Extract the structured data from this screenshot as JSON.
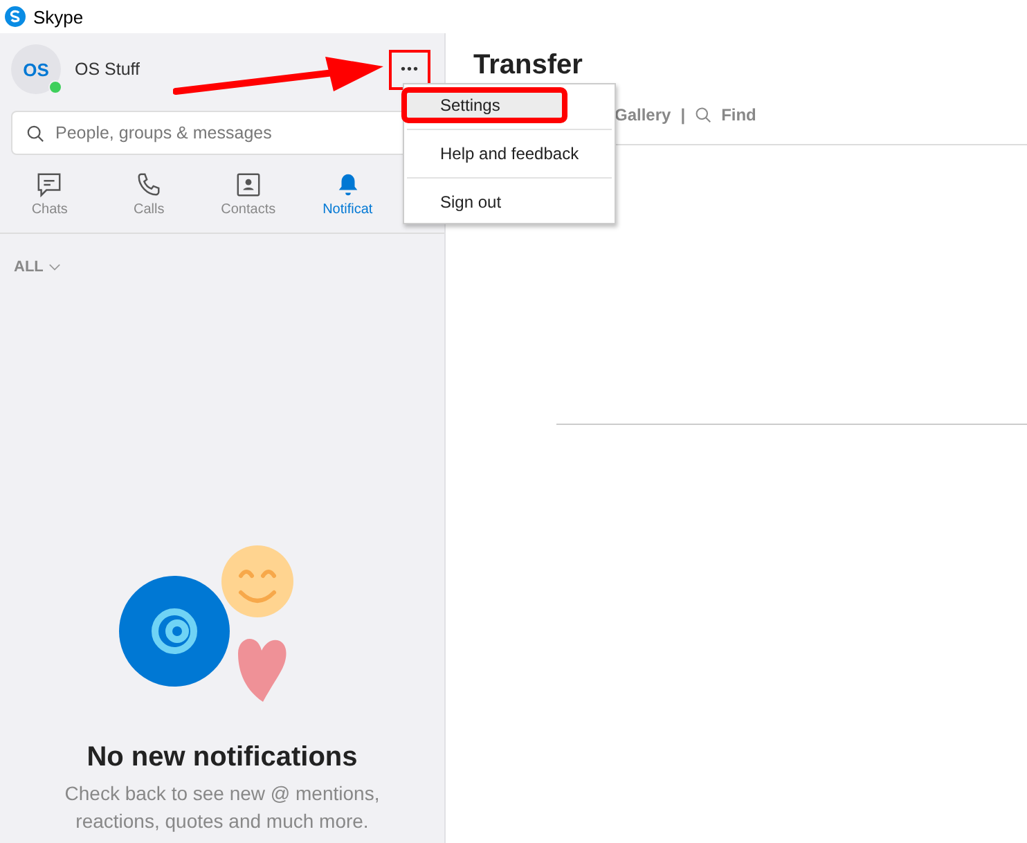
{
  "window": {
    "title": "Skype"
  },
  "profile": {
    "initials": "OS",
    "name": "OS Stuff",
    "online": true,
    "more": "•••",
    "highlighted": true
  },
  "search": {
    "placeholder": "People, groups & messages"
  },
  "tabs": [
    {
      "label": "Chats",
      "selected": false
    },
    {
      "label": "Calls",
      "selected": false
    },
    {
      "label": "Contacts",
      "selected": false
    },
    {
      "label": "Notificat",
      "selected": true
    }
  ],
  "filter": {
    "label": "ALL"
  },
  "empty_state": {
    "title": "No new notifications",
    "text": "Check back to see new @ mentions, reactions, quotes and much more."
  },
  "conversation": {
    "title": "Transfer",
    "toolbar": [
      "Gallery",
      "|",
      "Find"
    ]
  },
  "menu": {
    "items": [
      {
        "label": "Settings",
        "selected": true,
        "highlighted": true
      },
      {
        "label": "Help and feedback",
        "selected": false,
        "highlighted": false
      },
      {
        "label": "Sign out",
        "selected": false,
        "highlighted": false
      }
    ]
  }
}
